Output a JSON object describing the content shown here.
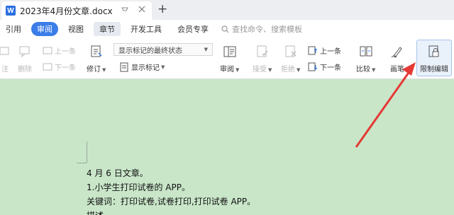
{
  "tab": {
    "icon_letter": "W",
    "title": "2023年4月份文章.docx",
    "add_symbol": "+"
  },
  "menubar": {
    "items": [
      "引用",
      "审阅",
      "视图",
      "章节",
      "开发工具",
      "会员专享"
    ],
    "active_index": 1,
    "search_placeholder": "查找命令、搜索模板"
  },
  "toolbar": {
    "partial_left_1": "注",
    "partial_left_2": "删除",
    "prev_comment": "上一条",
    "next_comment": "下一条",
    "revise": "修订",
    "markup_state": "显示标记的最终状态",
    "show_markup": "显示标记",
    "review": "审阅",
    "accept": "接受",
    "reject": "拒绝",
    "prev_change": "上一条",
    "next_change": "下一条",
    "compare": "比较",
    "ink": "画笔",
    "restrict_edit": "限制编辑"
  },
  "document": {
    "lines": [
      "4 月 6 日文章。",
      "1.小学生打印试卷的 APP。",
      "关键词：打印试卷,试卷打印,打印试卷 APP。",
      "描述"
    ]
  },
  "colors": {
    "doc_background": "#c9e6c9",
    "accent": "#3b7de9",
    "arrow": "#e53935"
  }
}
